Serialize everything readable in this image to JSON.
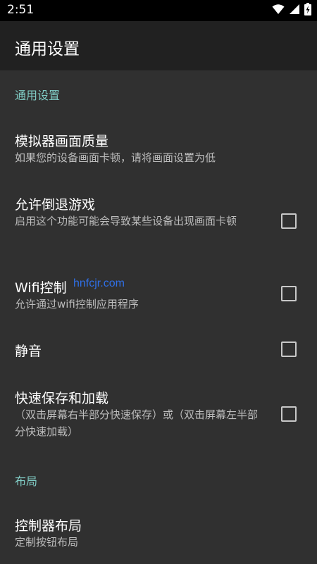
{
  "status_bar": {
    "time": "2:51"
  },
  "app_bar": {
    "title": "通用设置"
  },
  "sections": {
    "general": {
      "header": "通用设置"
    },
    "layout": {
      "header": "布局"
    }
  },
  "prefs": {
    "quality": {
      "title": "模拟器画面质量",
      "summary": "如果您的设备画面卡顿，请将画面设置为低"
    },
    "rewind": {
      "title": "允许倒退游戏",
      "summary": "启用这个功能可能会导致某些设备出现画面卡顿",
      "checked": false
    },
    "wifi": {
      "title": "Wifi控制",
      "summary": "允许通过wifi控制应用程序",
      "checked": false
    },
    "mute": {
      "title": "静音",
      "checked": false
    },
    "quicksave": {
      "title": "快速保存和加载",
      "summary": "（双击屏幕右半部分快速保存）或（双击屏幕左半部分快速加载）",
      "checked": false
    },
    "controller_layout": {
      "title": "控制器布局",
      "summary": "定制按钮布局"
    }
  },
  "watermark": "hnfcjr.com"
}
